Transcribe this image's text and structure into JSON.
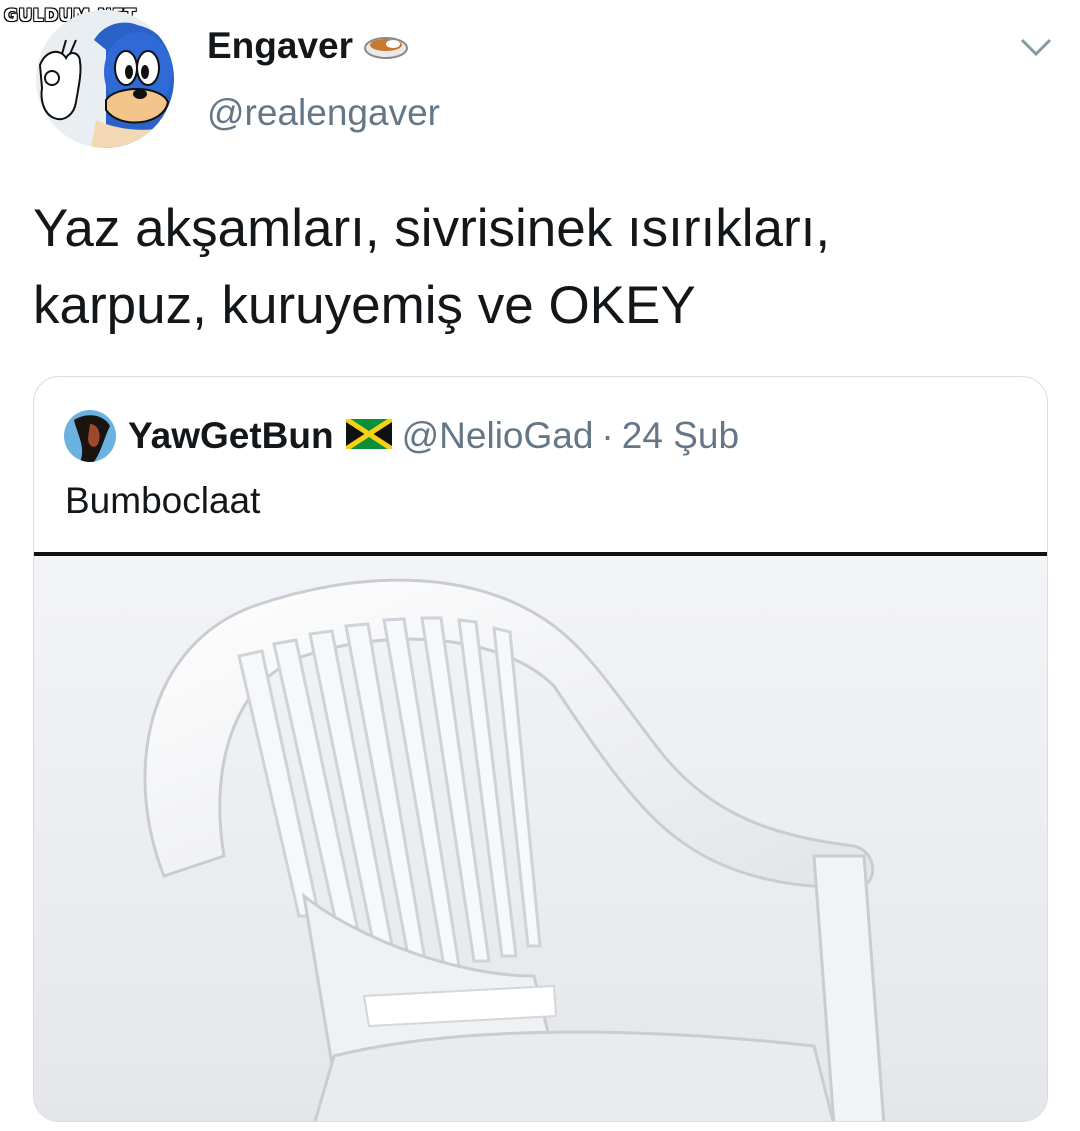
{
  "watermark": "GULDUM.NET",
  "tweet": {
    "author": {
      "display_name": "Engaver",
      "name_emoji": "curry-bowl-emoji",
      "handle": "@realengaver",
      "avatar": "sonic-avatar"
    },
    "menu_icon": "chevron-down-icon",
    "text_lines": [
      "Yaz akşamları, sivrisinek ısırıkları,",
      "karpuz, kuruyemiş ve OKEY"
    ]
  },
  "quoted_tweet": {
    "author": {
      "display_name": "YawGetBun",
      "flag_emoji": "jamaica-flag-emoji",
      "handle": "@NelioGad",
      "separator": "·",
      "date": "24 Şub"
    },
    "text": "Bumboclaat",
    "media": "white-plastic-chair-photo"
  },
  "colors": {
    "text_primary": "#14171a",
    "text_secondary": "#657786",
    "border": "#d8dde2",
    "background": "#ffffff"
  }
}
